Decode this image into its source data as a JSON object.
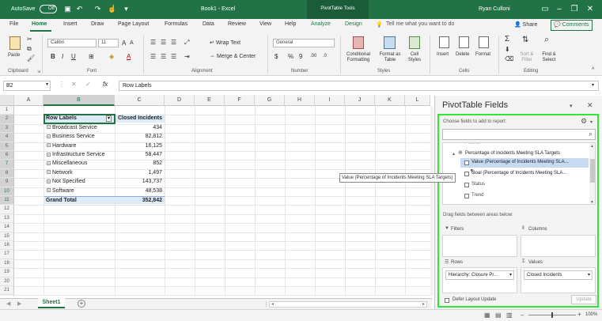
{
  "titlebar": {
    "autosave_label": "AutoSave",
    "autosave_state": "Off",
    "doc_title": "Book1  -  Excel",
    "context_tab": "PivotTable Tools",
    "user": "Ryan Culloni"
  },
  "tabs": [
    "File",
    "Home",
    "Insert",
    "Draw",
    "Page Layout",
    "Formulas",
    "Data",
    "Review",
    "View",
    "Help",
    "Analyze",
    "Design"
  ],
  "tell_me": "Tell me what you want to do",
  "share_label": "Share",
  "comments_label": "Comments",
  "ribbon": {
    "paste_label": "Paste",
    "font_name": "Calibri",
    "font_size": "11",
    "wrap_text": "Wrap Text",
    "merge_center": "Merge & Center",
    "number_format": "General",
    "conditional_formatting": "Conditional Formatting",
    "format_as_table": "Format as Table",
    "cell_styles": "Cell Styles",
    "insert": "Insert",
    "delete": "Delete",
    "format": "Format",
    "sort_filter": "Sort & Filter",
    "find_select": "Find & Select",
    "groups": [
      "Clipboard",
      "Font",
      "Alignment",
      "Number",
      "Styles",
      "Cells",
      "Editing"
    ]
  },
  "formula_bar": {
    "name_box": "B2",
    "fx": "fx",
    "content": "Row Labels"
  },
  "columns": [
    "A",
    "B",
    "C",
    "D",
    "E",
    "F",
    "G",
    "H",
    "I",
    "J",
    "K",
    "L"
  ],
  "rows": [
    "1",
    "2",
    "3",
    "4",
    "5",
    "6",
    "7",
    "8",
    "9",
    "10",
    "11",
    "12",
    "13",
    "14",
    "15",
    "16",
    "17",
    "18",
    "19",
    "20",
    "21",
    "22"
  ],
  "pivot": {
    "header_label": "Row Labels",
    "header_value": "Closed Incidents",
    "items": [
      {
        "label": "Broadcast Service",
        "value": "434"
      },
      {
        "label": "Business Service",
        "value": "82,812"
      },
      {
        "label": "Hardware",
        "value": "16,125"
      },
      {
        "label": "Infrastructure Service",
        "value": "58,447"
      },
      {
        "label": "Miscellaneous",
        "value": "852"
      },
      {
        "label": "Network",
        "value": "1,497"
      },
      {
        "label": "Not Specified",
        "value": "143,737"
      },
      {
        "label": "Software",
        "value": "48,538"
      }
    ],
    "total_label": "Grand Total",
    "total_value": "352,842"
  },
  "sheet_tab": "Sheet1",
  "panel": {
    "title": "PivotTable Fields",
    "choose_label": "Choose fields to add to report:",
    "fields": [
      {
        "label": "Percentage of Incidents Meeting SLA Targets",
        "checked": false
      },
      {
        "label": "Value (Percentage of Incidents Meeting SLA...",
        "checked": false
      },
      {
        "label": "Goal (Percentage of Incidents Meeting SLA...",
        "checked": false
      },
      {
        "label": "Status",
        "checked": false
      },
      {
        "label": "Trend",
        "checked": false
      }
    ],
    "tooltip": "Value (Percentage of Incidents Meeting SLA Targets)",
    "drag_label": "Drag fields between areas below:",
    "filters_label": "Filters",
    "columns_label": "Columns",
    "rows_label": "Rows",
    "values_label": "Values",
    "rows_field": "Hierarchy: Closure Pr...",
    "values_field": "Closed Incidents",
    "defer_label": "Defer Layout Update",
    "update_label": "Update"
  },
  "status": {
    "zoom": "100%"
  },
  "colors": {
    "excel_green": "#217346",
    "highlight": "#33e633"
  }
}
